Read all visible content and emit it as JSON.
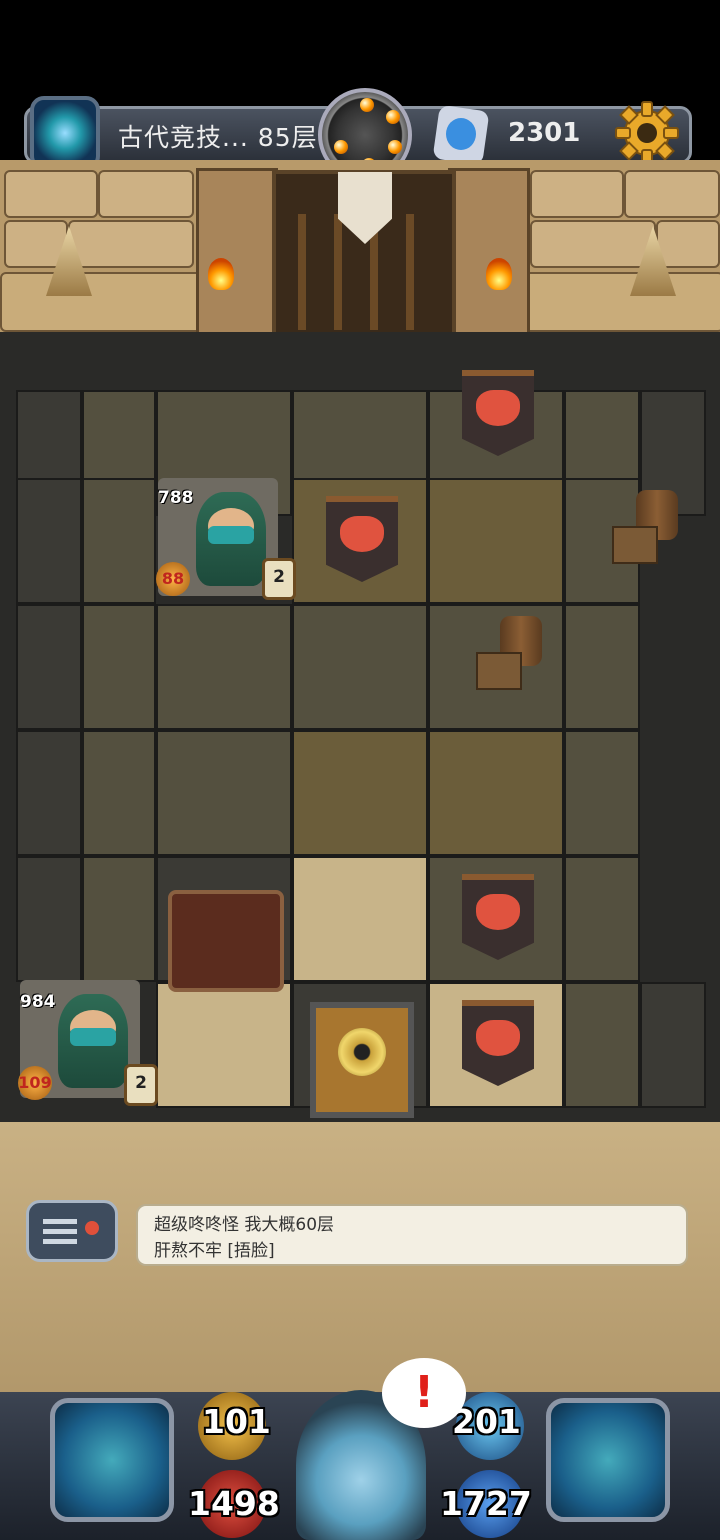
{
  "header": {
    "floor_label": "古代竞技... 85层",
    "currency_amount": "2301",
    "icons": {
      "portal": "portal-icon",
      "bomb": "bomb-icon",
      "gem": "gem-icon",
      "settings": "gear-icon",
      "profile": "avatar-icon"
    }
  },
  "board": {
    "monsters": [
      {
        "hp": "788",
        "attack": "88",
        "level": "2"
      },
      {
        "hp": "984",
        "attack": "109",
        "level": "2"
      }
    ]
  },
  "chat": {
    "line1": "超级咚咚怪  我大概60层",
    "line2": "肝熬不牢 [捂脸]"
  },
  "hud": {
    "attack": "101",
    "defense": "201",
    "hp": "1498",
    "mana": "1727",
    "alert": "!"
  },
  "colors": {
    "accent_gold": "#f0b030",
    "hp_red": "#c0261e",
    "mana_blue": "#2a7fd0"
  }
}
